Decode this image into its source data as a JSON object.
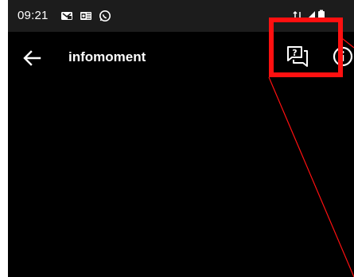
{
  "status_bar": {
    "time": "09:21",
    "left_icons": [
      "message-notification-icon",
      "outlook-icon",
      "whatsapp-icon"
    ],
    "right_icons": [
      "data-transfer-icon",
      "signal-icon",
      "battery-icon"
    ]
  },
  "toolbar": {
    "title": "infomoment",
    "back_icon": "arrow-left-icon",
    "faq_icon": "question-chat-icon",
    "info_icon": "info-circle-icon"
  },
  "colors": {
    "status_bar_bg": "#1c1c1c",
    "screen_bg": "#000000",
    "text": "#ffffff",
    "annotation": "#ff1010"
  }
}
